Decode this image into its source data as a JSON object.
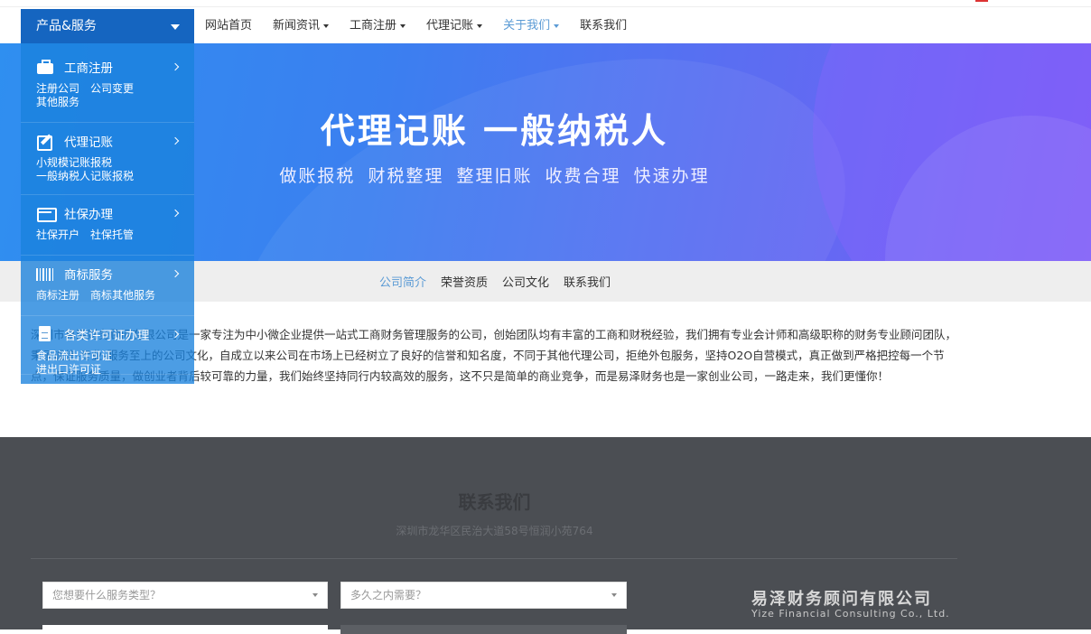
{
  "nav": {
    "product_menu": "产品&服务",
    "links": [
      {
        "label": "网站首页",
        "dropdown": false,
        "active": false
      },
      {
        "label": "新闻资讯",
        "dropdown": true,
        "active": false
      },
      {
        "label": "工商注册",
        "dropdown": true,
        "active": false
      },
      {
        "label": "代理记账",
        "dropdown": true,
        "active": false
      },
      {
        "label": "关于我们",
        "dropdown": true,
        "active": true
      },
      {
        "label": "联系我们",
        "dropdown": false,
        "active": false
      }
    ]
  },
  "menu": {
    "sections": [
      {
        "title": "工商注册",
        "icon": "briefcase-icon",
        "subs": [
          "注册公司",
          "公司变更",
          "其他服务"
        ]
      },
      {
        "title": "代理记账",
        "icon": "edit-icon",
        "subs": [
          "小规模记账报税",
          "一般纳税人记账报税"
        ]
      },
      {
        "title": "社保办理",
        "icon": "card-icon",
        "subs": [
          "社保开户",
          "社保托管"
        ]
      },
      {
        "title": "商标服务",
        "icon": "barcode-icon",
        "subs": [
          "商标注册",
          "商标其他服务"
        ]
      },
      {
        "title": "各类许可证办理",
        "icon": "document-icon",
        "subs": [
          "食品流出许可证",
          "进出口许可证"
        ]
      }
    ]
  },
  "banner": {
    "title": "代理记账  一般纳税人",
    "subtitle": "做账报税 财税整理 整理旧账 收费合理 快速办理"
  },
  "subnav": {
    "items": [
      {
        "label": "公司简介",
        "active": true
      },
      {
        "label": "荣誉资质",
        "active": false
      },
      {
        "label": "公司文化",
        "active": false
      },
      {
        "label": "联系我们",
        "active": false
      }
    ]
  },
  "intro": {
    "text": "深圳市易泽财务顾问有限公司是一家专注为中小微企业提供一站式工商财务管理服务的公司，创始团队均有丰富的工商和财税经验，我们拥有专业会计师和高级职称的财务专业顾问团队，秉承诚信-专业-服务至上的公司文化，自成立以来公司在市场上已经树立了良好的信誉和知名度，不同于其他代理公司，拒绝外包服务，坚持O2O自营模式，真正做到严格把控每一个节点，保证服务质量，做创业者背后较可靠的力量，我们始终坚持同行内较高效的服务，这不只是简单的商业竞争，而是易泽财务也是一家创业公司，一路走来，我们更懂你！"
  },
  "footer": {
    "title": "联系我们",
    "address": "深圳市龙华区民治大道58号恒润小苑764",
    "select1_placeholder": "您想要什么服务类型？",
    "select2_placeholder": "多久之内需要？",
    "company_cn": "易泽财务顾问有限公司",
    "company_en": "Yize Financial Consulting Co., Ltd."
  }
}
